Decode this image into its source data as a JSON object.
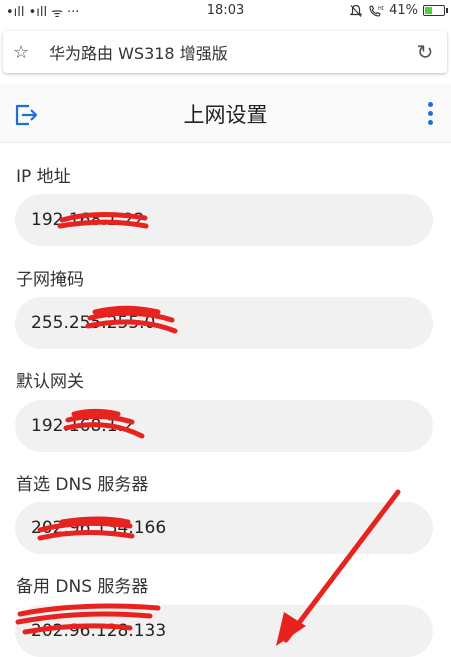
{
  "status_bar": {
    "signal": "•ıll •ıll",
    "wifi": "ᯤ",
    "more": "···",
    "time": "18:03",
    "battery_level": "41%",
    "battery_fraction": 0.41
  },
  "url_bar": {
    "title": "华为路由 WS318 增强版"
  },
  "header": {
    "title": "上网设置"
  },
  "fields": [
    {
      "label": "IP 地址",
      "value": "192.168.1.22"
    },
    {
      "label": "子网掩码",
      "value": "255.255.255.0"
    },
    {
      "label": "默认网关",
      "value": "192.168.1.2"
    },
    {
      "label": "首选 DNS 服务器",
      "value": "202.96.134.166"
    },
    {
      "label": "备用 DNS 服务器",
      "value": "202.96.128.133"
    }
  ],
  "colors": {
    "accent": "#1e6fd9",
    "redaction": "#e8231f",
    "field_bg": "#f1f1f1"
  }
}
